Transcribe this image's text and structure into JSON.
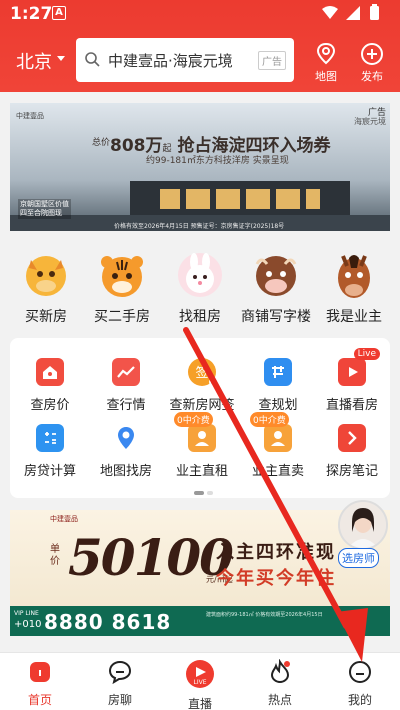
{
  "status_bar": {
    "time": "1:27",
    "app_icon": "A"
  },
  "header": {
    "city": "北京",
    "search_text": "中建壹品·海宸元境",
    "search_ad": "广告",
    "map_label": "地图",
    "publish_label": "发布"
  },
  "banner_top": {
    "ad_label": "广告",
    "brand": "海宸元境",
    "logo": "中建壹品",
    "price_prefix": "总价",
    "price": "808万",
    "price_suffix": "起",
    "headline": "抢占海淀四环入场券",
    "subline": "约99-181㎡东方科技洋房 实景呈现",
    "left_tag_1": "京朝国墅区价值",
    "left_tag_2": "四至合院图现",
    "footer": "价格有效至2026年4月15日 预售证号：京房售证字(2025)18号"
  },
  "quick_nav": [
    {
      "label": "买新房",
      "icon": "dragon-avatar-icon"
    },
    {
      "label": "买二手房",
      "icon": "tiger-avatar-icon"
    },
    {
      "label": "找租房",
      "icon": "rabbit-avatar-icon"
    },
    {
      "label": "商铺写字楼",
      "icon": "ox-avatar-icon"
    },
    {
      "label": "我是业主",
      "icon": "horse-avatar-icon"
    }
  ],
  "tools": [
    {
      "label": "查房价",
      "icon": "house-price-icon"
    },
    {
      "label": "查行情",
      "icon": "trend-icon"
    },
    {
      "label": "查新房网签",
      "icon": "contract-icon",
      "badge": "签"
    },
    {
      "label": "查规划",
      "icon": "plan-icon"
    },
    {
      "label": "直播看房",
      "icon": "live-video-icon",
      "badge": "Live"
    },
    {
      "label": "房贷计算",
      "icon": "calculator-icon"
    },
    {
      "label": "地图找房",
      "icon": "map-pin-icon"
    },
    {
      "label": "业主直租",
      "icon": "owner-rent-icon",
      "badge": "0中介费"
    },
    {
      "label": "业主直卖",
      "icon": "owner-sell-icon",
      "badge": "0中介费"
    },
    {
      "label": "探房笔记",
      "icon": "notes-icon"
    }
  ],
  "banner_bottom": {
    "logo": "中建壹品",
    "unit_label": "单价",
    "price": "50100",
    "price_suffix": "元/㎡起",
    "line1": "入主四环准现",
    "line2": "今年买今年住",
    "vip_label": "VIP LINE",
    "phone_prefix": "+010",
    "phone": "8880 8618",
    "fine_print": "建筑面积约99-181㎡ 价格有效期至2026年4月15日"
  },
  "agent": {
    "label": "选房师"
  },
  "tabbar": {
    "items": [
      {
        "label": "首页",
        "icon": "home-icon",
        "active": true
      },
      {
        "label": "房聊",
        "icon": "chat-icon",
        "active": false
      },
      {
        "label": "直播",
        "icon": "live-icon",
        "active": false
      },
      {
        "label": "热点",
        "icon": "flame-icon",
        "active": false
      },
      {
        "label": "我的",
        "icon": "profile-icon",
        "active": false
      }
    ]
  },
  "colors": {
    "brand_red": "#ec3b30",
    "annotation_arrow": "#e8281f"
  }
}
